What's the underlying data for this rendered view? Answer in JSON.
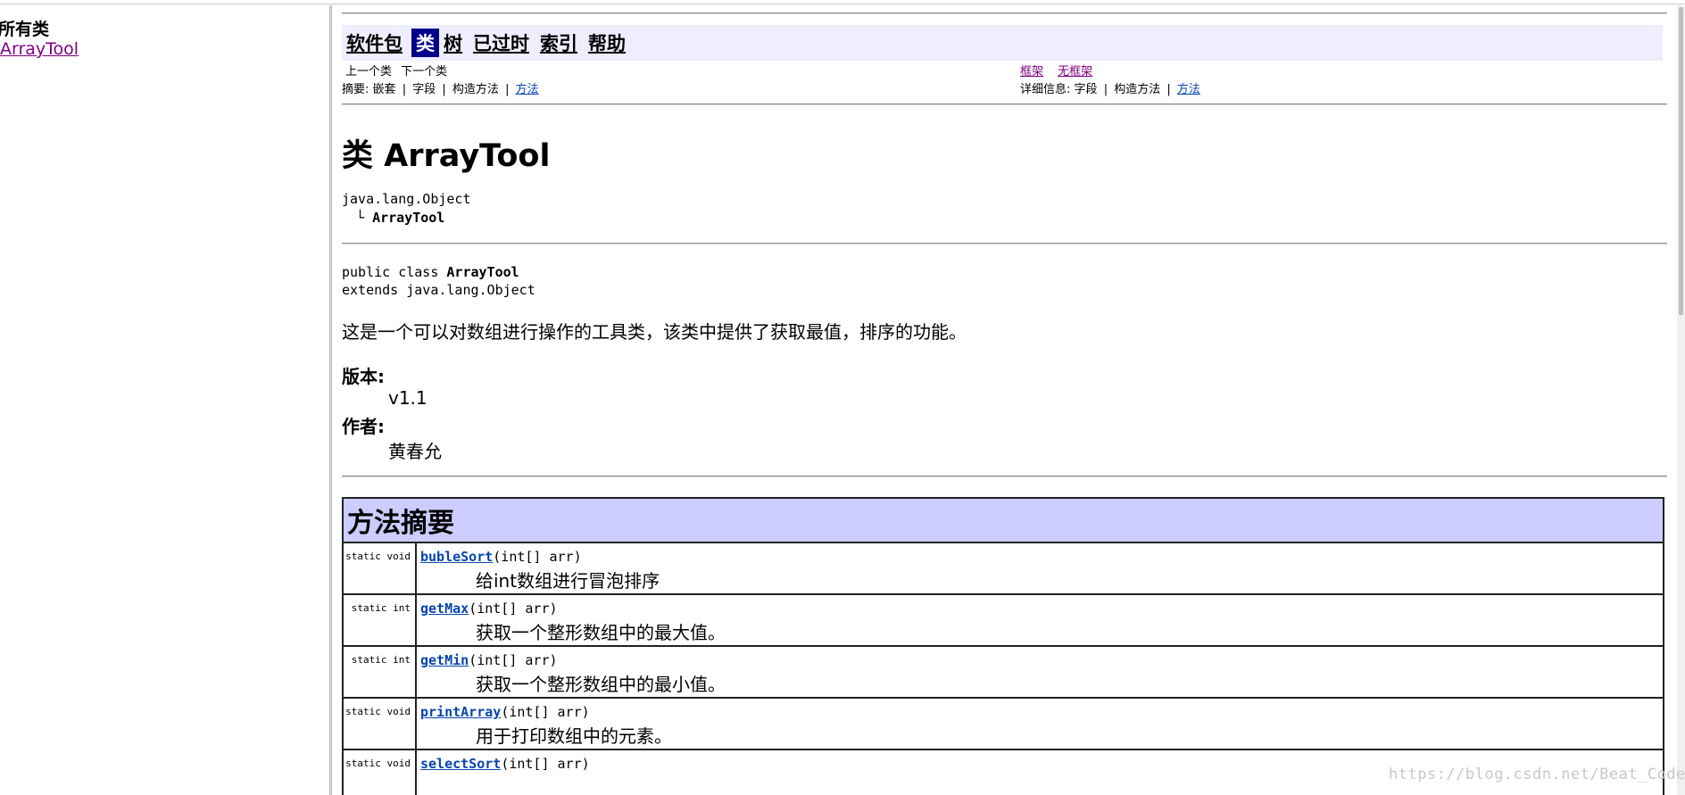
{
  "left_frame": {
    "title": "所有类",
    "class_link": "ArrayTool"
  },
  "navbar": {
    "items": [
      "软件包",
      "类",
      "树",
      "已过时",
      "索引",
      "帮助"
    ],
    "selected": "类"
  },
  "subnav": {
    "prev_class": "上一个类",
    "next_class": "下一个类",
    "frames": "框架",
    "no_frames": "无框架",
    "summary_label": "摘要:",
    "summary_nested": "嵌套",
    "summary_field": "字段",
    "summary_constructor": "构造方法",
    "summary_method": "方法",
    "detail_label": "详细信息:",
    "detail_field": "字段",
    "detail_constructor": "构造方法",
    "detail_method": "方法",
    "separator": "|"
  },
  "class_info": {
    "title": "类 ArrayTool",
    "inherit_parent": "java.lang.Object",
    "inherit_branch": "└",
    "inherit_child": "ArrayTool",
    "decl_prefix": "public class ",
    "decl_name": "ArrayTool",
    "decl_extends": "extends java.lang.Object",
    "description": "这是一个可以对数组进行操作的工具类，该类中提供了获取最值，排序的功能。",
    "version_label": "版本:",
    "version_value": "v1.1",
    "author_label": "作者:",
    "author_value": "黄春允"
  },
  "method_summary": {
    "title": "方法摘要",
    "methods": [
      {
        "modifier": "static void",
        "name": "bubleSort",
        "params": "(int[] arr)",
        "desc": "给int数组进行冒泡排序"
      },
      {
        "modifier": "static int",
        "name": "getMax",
        "params": "(int[] arr)",
        "desc": "获取一个整形数组中的最大值。"
      },
      {
        "modifier": "static int",
        "name": "getMin",
        "params": "(int[] arr)",
        "desc": "获取一个整形数组中的最小值。"
      },
      {
        "modifier": "static void",
        "name": "printArray",
        "params": "(int[] arr)",
        "desc": "用于打印数组中的元素。"
      },
      {
        "modifier": "static void",
        "name": "selectSort",
        "params": "(int[] arr)",
        "desc": ""
      }
    ]
  },
  "watermark": "https://blog.csdn.net/Beat_Coder",
  "colors": {
    "navbar_bg": "#eeeeff",
    "nav_selected_bg": "#00008b",
    "table_header_bg": "#ccccff",
    "link": "#0645ad",
    "visited": "#800080"
  }
}
